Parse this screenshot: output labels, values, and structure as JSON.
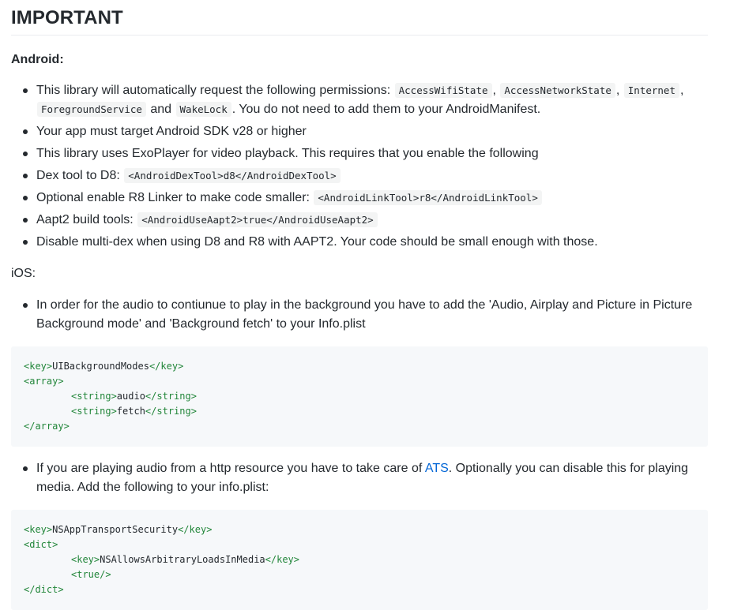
{
  "heading": "IMPORTANT",
  "android": {
    "label": "Android:",
    "items": [
      {
        "parts": [
          {
            "t": "text",
            "v": "This library will automatically request the following permissions: "
          },
          {
            "t": "code",
            "v": "AccessWifiState"
          },
          {
            "t": "text",
            "v": ", "
          },
          {
            "t": "code",
            "v": "AccessNetworkState"
          },
          {
            "t": "text",
            "v": ", "
          },
          {
            "t": "code",
            "v": "Internet"
          },
          {
            "t": "text",
            "v": ", "
          },
          {
            "t": "code",
            "v": "ForegroundService"
          },
          {
            "t": "text",
            "v": " and "
          },
          {
            "t": "code",
            "v": "WakeLock"
          },
          {
            "t": "text",
            "v": ". You do not need to add them to your AndroidManifest."
          }
        ]
      },
      {
        "parts": [
          {
            "t": "text",
            "v": "Your app must target Android SDK v28 or higher"
          }
        ]
      },
      {
        "parts": [
          {
            "t": "text",
            "v": "This library uses ExoPlayer for video playback. This requires that you enable the following"
          }
        ]
      },
      {
        "parts": [
          {
            "t": "text",
            "v": "Dex tool to D8: "
          },
          {
            "t": "code",
            "v": "<AndroidDexTool>d8</AndroidDexTool>"
          }
        ]
      },
      {
        "parts": [
          {
            "t": "text",
            "v": "Optional enable R8 Linker to make code smaller: "
          },
          {
            "t": "code",
            "v": "<AndroidLinkTool>r8</AndroidLinkTool>"
          }
        ]
      },
      {
        "parts": [
          {
            "t": "text",
            "v": "Aapt2 build tools: "
          },
          {
            "t": "code",
            "v": "<AndroidUseAapt2>true</AndroidUseAapt2>"
          }
        ]
      },
      {
        "parts": [
          {
            "t": "text",
            "v": "Disable multi-dex when using D8 and R8 with AAPT2. Your code should be small enough with those."
          }
        ]
      }
    ]
  },
  "ios": {
    "label": "iOS:",
    "item1": "In order for the audio to contiunue to play in the background you have to add the 'Audio, Airplay and Picture in Picture Background mode' and 'Background fetch' to your Info.plist",
    "code1": [
      {
        "indent": false,
        "parts": [
          {
            "t": "tag",
            "v": "<key>"
          },
          {
            "t": "text",
            "v": "UIBackgroundModes"
          },
          {
            "t": "tag",
            "v": "</key>"
          }
        ]
      },
      {
        "indent": false,
        "parts": [
          {
            "t": "tag",
            "v": "<array>"
          }
        ]
      },
      {
        "indent": true,
        "parts": [
          {
            "t": "tag",
            "v": "<string>"
          },
          {
            "t": "text",
            "v": "audio"
          },
          {
            "t": "tag",
            "v": "</string>"
          }
        ]
      },
      {
        "indent": true,
        "parts": [
          {
            "t": "tag",
            "v": "<string>"
          },
          {
            "t": "text",
            "v": "fetch"
          },
          {
            "t": "tag",
            "v": "</string>"
          }
        ]
      },
      {
        "indent": false,
        "parts": [
          {
            "t": "tag",
            "v": "</array>"
          }
        ]
      }
    ],
    "item2_before": "If you are playing audio from a http resource you have to take care of ",
    "item2_link": "ATS",
    "item2_after": ". Optionally you can disable this for playing media. Add the following to your info.plist:",
    "code2": [
      {
        "indent": false,
        "parts": [
          {
            "t": "tag",
            "v": "<key>"
          },
          {
            "t": "text",
            "v": "NSAppTransportSecurity"
          },
          {
            "t": "tag",
            "v": "</key>"
          }
        ]
      },
      {
        "indent": false,
        "parts": [
          {
            "t": "tag",
            "v": "<dict>"
          }
        ]
      },
      {
        "indent": true,
        "parts": [
          {
            "t": "tag",
            "v": "<key>"
          },
          {
            "t": "text",
            "v": "NSAllowsArbitraryLoadsInMedia"
          },
          {
            "t": "tag",
            "v": "</key>"
          }
        ]
      },
      {
        "indent": true,
        "parts": [
          {
            "t": "tag",
            "v": "<true/>"
          }
        ]
      },
      {
        "indent": false,
        "parts": [
          {
            "t": "tag",
            "v": "</dict>"
          }
        ]
      }
    ]
  }
}
